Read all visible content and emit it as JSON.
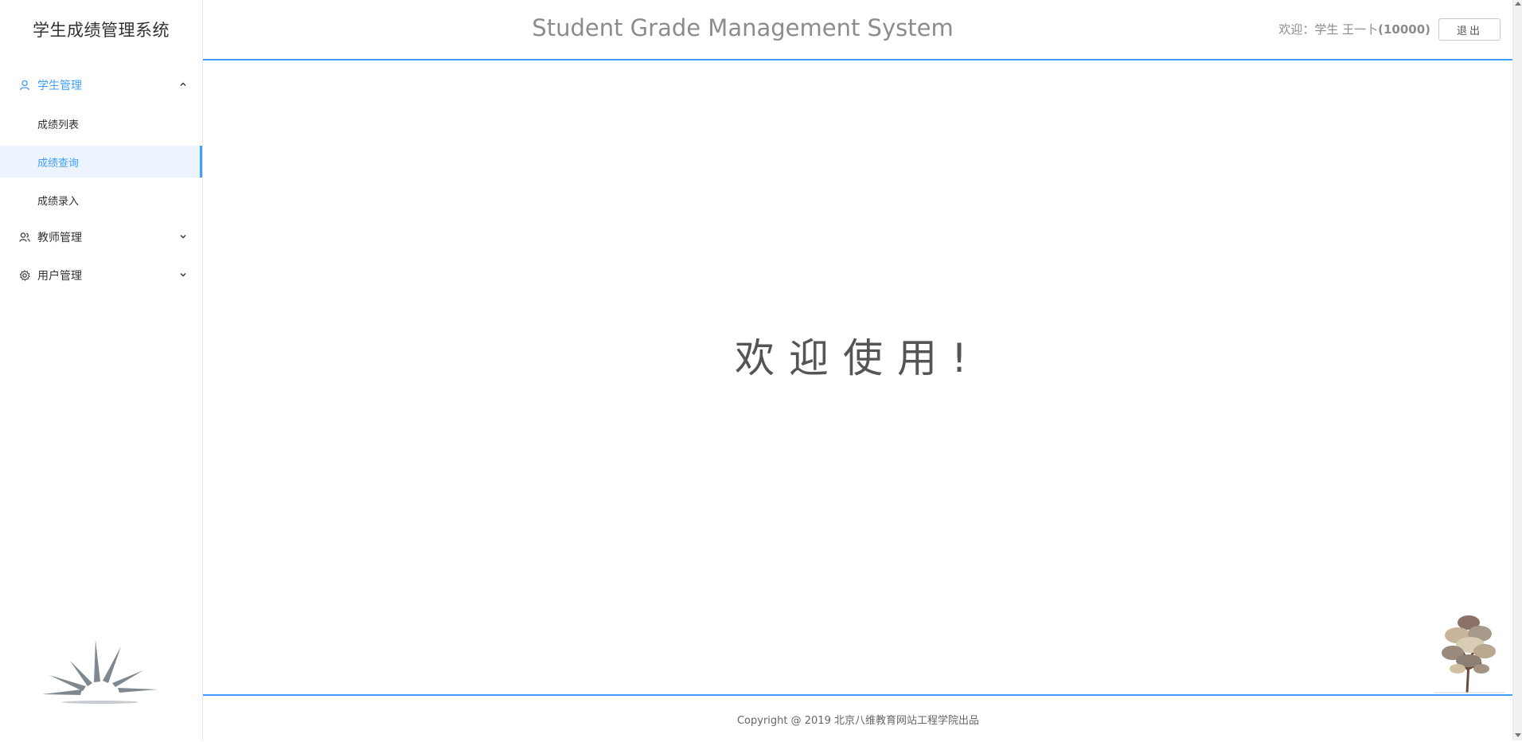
{
  "sidebar": {
    "app_title": "学生成绩管理系统",
    "groups": [
      {
        "label": "学生管理",
        "icon": "user-icon",
        "expanded": true,
        "items": [
          {
            "label": "成绩列表",
            "selected": false
          },
          {
            "label": "成绩查询",
            "selected": true
          },
          {
            "label": "成绩录入",
            "selected": false
          }
        ]
      },
      {
        "label": "教师管理",
        "icon": "users-icon",
        "expanded": false
      },
      {
        "label": "用户管理",
        "icon": "gear-icon",
        "expanded": false
      }
    ]
  },
  "header": {
    "title": "Student Grade Management System",
    "welcome_prefix": "欢迎：学生 王一卜",
    "user_id": "(10000)",
    "logout_label": "退出"
  },
  "main": {
    "welcome_text": "欢迎使用!"
  },
  "footer": {
    "copyright": "Copyright @ 2019 北京八维教育网站工程学院出品"
  },
  "colors": {
    "accent": "#409eff",
    "selected_bg": "#ecf5ff",
    "title_gray": "#8c8c8c"
  }
}
